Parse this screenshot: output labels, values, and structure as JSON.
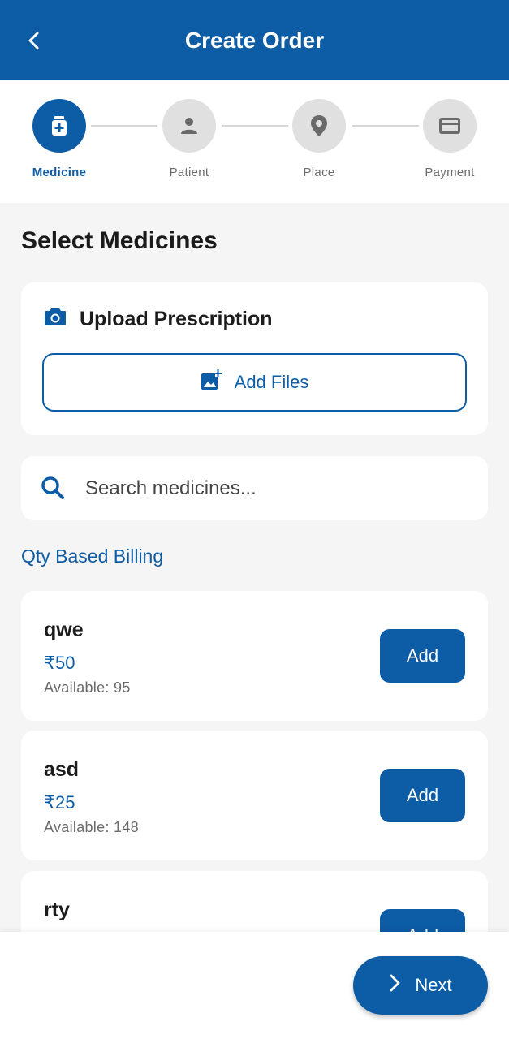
{
  "header": {
    "title": "Create Order",
    "back_icon": "back-arrow-icon"
  },
  "stepper": {
    "steps": [
      {
        "label": "Medicine",
        "icon": "medicine-icon",
        "active": true
      },
      {
        "label": "Patient",
        "icon": "person-icon",
        "active": false
      },
      {
        "label": "Place",
        "icon": "location-pin-icon",
        "active": false
      },
      {
        "label": "Payment",
        "icon": "credit-card-icon",
        "active": false
      }
    ]
  },
  "main": {
    "section_title": "Select Medicines",
    "upload": {
      "title": "Upload Prescription",
      "button_label": "Add Files"
    },
    "search": {
      "placeholder": "Search medicines..."
    },
    "billing_label": "Qty Based Billing",
    "medicines": [
      {
        "name": "qwe",
        "price": "₹50",
        "available": "Available: 95",
        "button": "Add"
      },
      {
        "name": "asd",
        "price": "₹25",
        "available": "Available: 148",
        "button": "Add"
      },
      {
        "name": "rty",
        "price": "",
        "available": "",
        "button": "Add"
      }
    ]
  },
  "footer": {
    "next_label": "Next"
  },
  "colors": {
    "primary": "#0d5ca6",
    "background": "#f5f5f5",
    "inactive_step": "#e0e0e0"
  }
}
